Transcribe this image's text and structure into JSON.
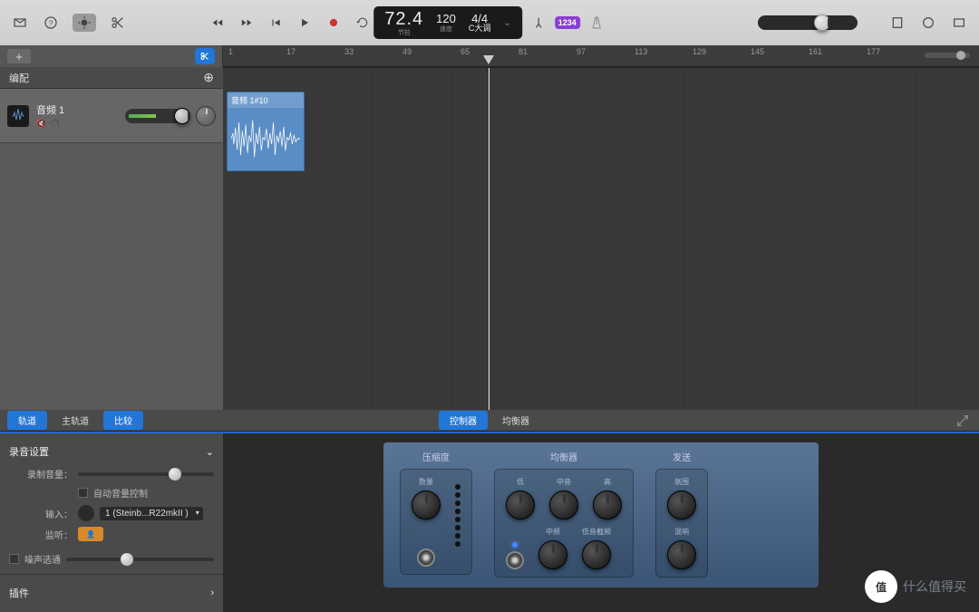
{
  "lcd": {
    "bars": "72.4",
    "bars_label": "节拍",
    "bpm": "120",
    "bpm_label": "速度",
    "timesig": "4/4",
    "key": "C大调"
  },
  "badge_1234": "1234",
  "ruler_ticks": [
    "1",
    "17",
    "33",
    "49",
    "65",
    "81",
    "97",
    "113",
    "129",
    "145",
    "161",
    "177"
  ],
  "arrange_header": {
    "label": "编配"
  },
  "track": {
    "name": "音频 1",
    "region_label": "音频 1#10"
  },
  "tabs": {
    "left": [
      "轨道",
      "主轨道",
      "比较"
    ],
    "center": [
      "控制器",
      "均衡器"
    ]
  },
  "recording": {
    "section_title": "录音设置",
    "volume_label": "录制音量：",
    "auto_level": "自动音量控制",
    "input_label": "输入：",
    "input_value": "1 (Steinb...R22mkII )",
    "monitor_label": "监听：",
    "noise_gate": "噪声选通"
  },
  "plugins_label": "插件",
  "plugin": {
    "compressor": {
      "title": "压缩度",
      "knobs": [
        "数量"
      ]
    },
    "eq": {
      "title": "均衡器",
      "top": [
        "低",
        "中音",
        "高"
      ],
      "bottom": [
        "中频",
        "低音截频"
      ]
    },
    "send": {
      "title": "发送",
      "knobs": [
        "氛围",
        "混响"
      ]
    }
  },
  "watermark": {
    "badge": "值",
    "text": "什么值得买"
  }
}
